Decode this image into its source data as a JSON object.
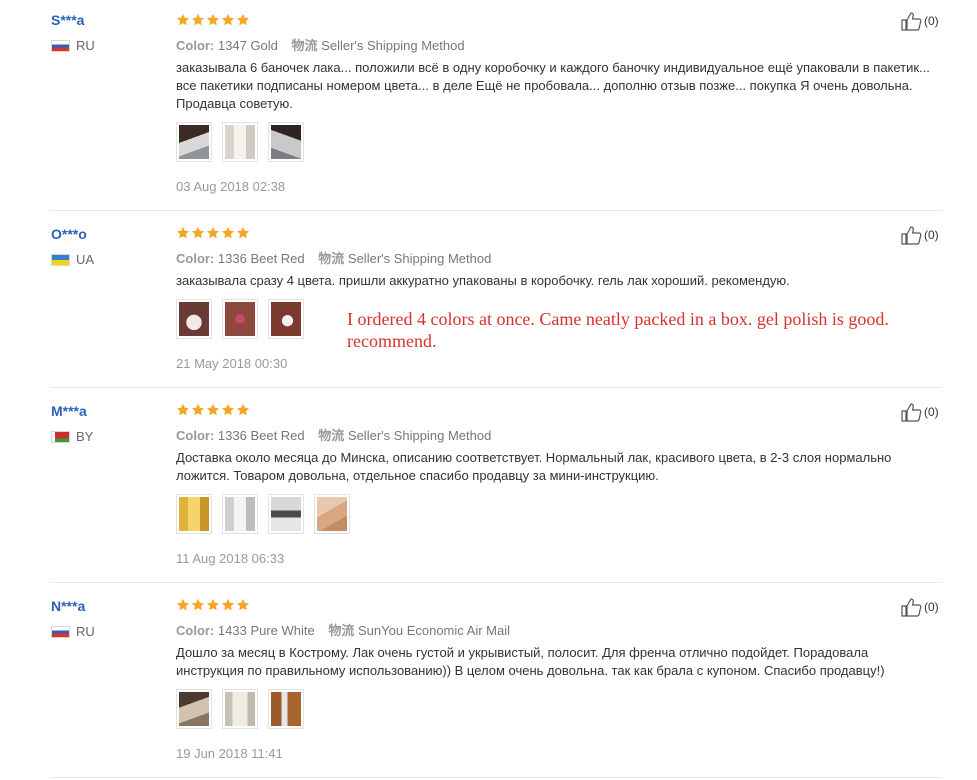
{
  "labels": {
    "color": "Color:",
    "shipping": "物流"
  },
  "colors": {
    "username": "#2a62b7",
    "star": "#f5a623",
    "translation": "#d8312e"
  },
  "reviews": [
    {
      "user": "S***a",
      "country": "RU",
      "flag": "ru-flag-icon",
      "rating": 5,
      "color_value": "1347 Gold",
      "shipping_value": "Seller's Shipping Method",
      "text": "заказывала 6 баночек лака... положили всё в одну коробочку и каждого баночку индивидуальное ещё упаковали в пакетик... все пакетики подписаны номером цвета... в деле Ещё не пробовала... дополню отзыв позже... покупка Я очень довольна. Продавца советую.",
      "photos": 3,
      "date": "03 Aug 2018 02:38",
      "likes": "(0)"
    },
    {
      "user": "O***o",
      "country": "UA",
      "flag": "ua-flag-icon",
      "rating": 5,
      "color_value": "1336 Beet Red",
      "shipping_value": "Seller's Shipping Method",
      "text": "заказывала сразу 4 цвета. пришли аккуратно упакованы в коробочку. гель лак хороший. рекомендую.",
      "photos": 3,
      "date": "21 May 2018 00:30",
      "likes": "(0)"
    },
    {
      "user": "M***a",
      "country": "BY",
      "flag": "by-flag-icon",
      "rating": 5,
      "color_value": "1336 Beet Red",
      "shipping_value": "Seller's Shipping Method",
      "text": "Доставка около месяца до Минска, описанию соответствует. Нормальный лак, красивого цвета, в 2-3 слоя нормально ложится. Товаром довольна, отдельное спасибо продавцу за мини-инструкцию.",
      "photos": 4,
      "date": "11 Aug 2018 06:33",
      "likes": "(0)"
    },
    {
      "user": "N***a",
      "country": "RU",
      "flag": "ru-flag-icon",
      "rating": 5,
      "color_value": "1433 Pure White",
      "shipping_value": "SunYou Economic Air Mail",
      "text": "Дошло за месяц в Кострому. Лак очень густой и укрывистый, полосит. Для френча отлично подойдет. Порадовала инструкция по правильному использованию)) В целом очень довольна. так как брала с купоном. Спасибо продавцу!)",
      "photos": 3,
      "date": "19 Jun 2018 11:41",
      "likes": "(0)"
    }
  ],
  "translation_note": "I ordered 4 colors at once. Came neatly packed in a box. gel polish is good. recommend."
}
